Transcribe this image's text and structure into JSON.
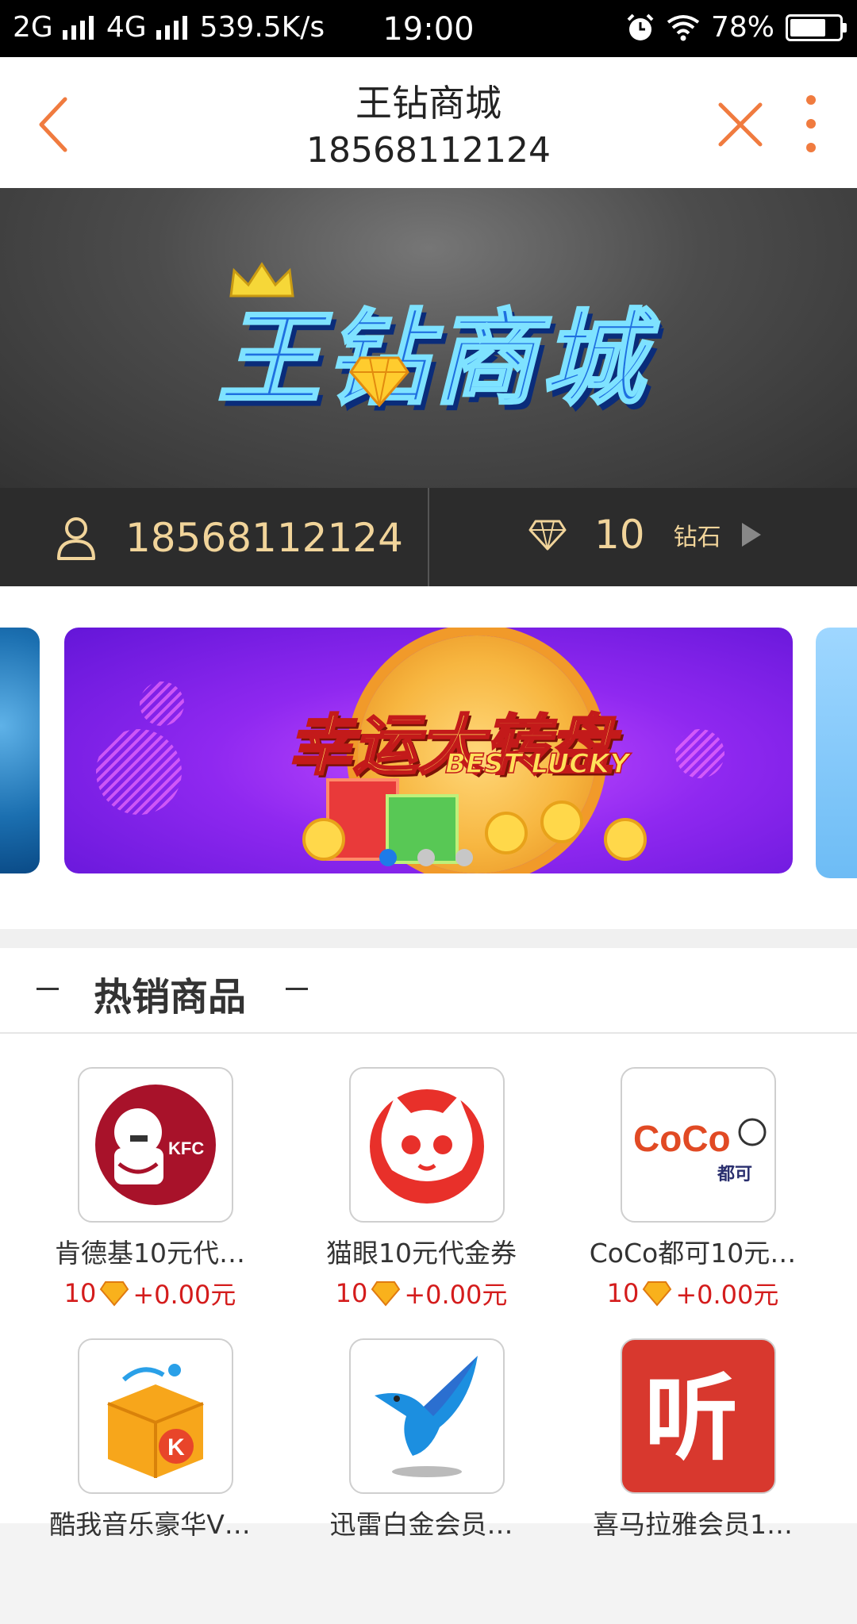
{
  "status_bar": {
    "net1": "2G",
    "net2": "4G",
    "speed": "539.5K/s",
    "time": "19:00",
    "battery": "78%",
    "battery_level": 0.78
  },
  "header": {
    "title": "王钻商城",
    "subtitle": "18568112124",
    "back_icon": "chevron-left-icon",
    "close_icon": "close-icon",
    "more_icon": "more-vertical-icon",
    "accent_color": "#f07b3f"
  },
  "hero": {
    "logo_text": "王钻商城"
  },
  "account": {
    "phone": "18568112124",
    "diamond_count": "10",
    "diamond_unit": "钻石",
    "text_color": "#f1d49a"
  },
  "carousel": {
    "title": "幸运大转盘",
    "subtitle": "BEST LUCKY",
    "slide_count": 3,
    "active_index": 0
  },
  "section": {
    "title": "热销商品"
  },
  "products": [
    {
      "name": "肯德基10元代…",
      "diamonds": "10",
      "price": "+0.00元",
      "logo_text": "KFC"
    },
    {
      "name": "猫眼10元代金券",
      "diamonds": "10",
      "price": "+0.00元",
      "logo_text": ""
    },
    {
      "name": "CoCo都可10元…",
      "diamonds": "10",
      "price": "+0.00元",
      "logo_text": "CoCo",
      "logo_sub": "都可"
    },
    {
      "name": "酷我音乐豪华V…",
      "diamonds": "",
      "price": "",
      "logo_text": "K"
    },
    {
      "name": "迅雷白金会员…",
      "diamonds": "",
      "price": "",
      "logo_text": ""
    },
    {
      "name": "喜马拉雅会员1…",
      "diamonds": "",
      "price": "",
      "logo_text": "听"
    }
  ]
}
